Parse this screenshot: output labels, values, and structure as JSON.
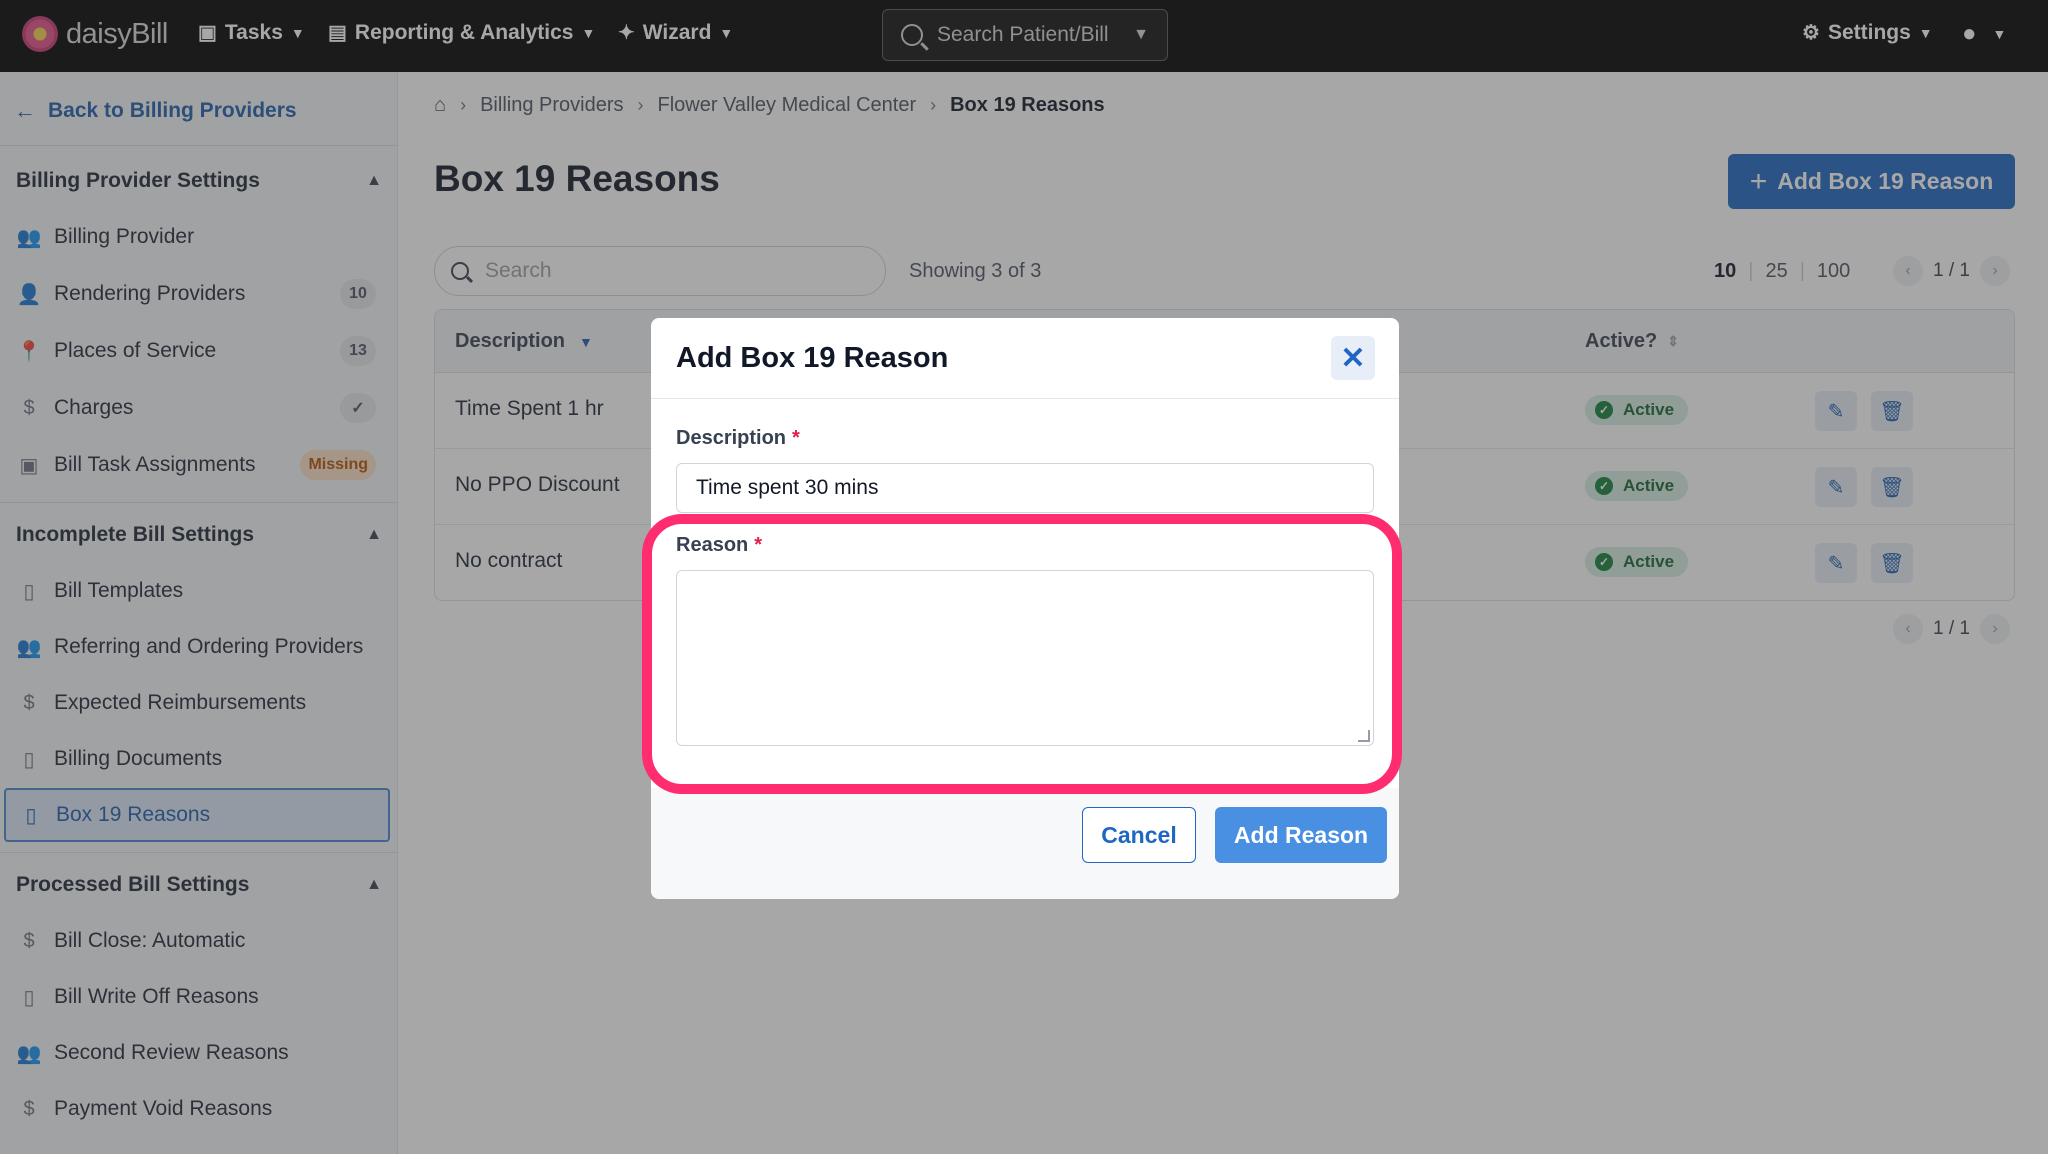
{
  "topnav": {
    "brand": "daisyBill",
    "tasks": "Tasks",
    "reporting": "Reporting & Analytics",
    "wizard": "Wizard",
    "search_placeholder": "Search Patient/Bill",
    "settings": "Settings"
  },
  "sidebar": {
    "back": "Back to Billing Providers",
    "sections": {
      "billing_provider_settings": "Billing Provider Settings",
      "incomplete_bill_settings": "Incomplete Bill Settings",
      "processed_bill_settings": "Processed Bill Settings"
    },
    "items": [
      {
        "label": "Billing Provider"
      },
      {
        "label": "Rendering Providers",
        "badge": "10"
      },
      {
        "label": "Places of Service",
        "badge": "13"
      },
      {
        "label": "Charges",
        "badge": "✓"
      },
      {
        "label": "Bill Task Assignments",
        "badge": "Missing"
      },
      {
        "label": "Bill Templates"
      },
      {
        "label": "Referring and Ordering Providers"
      },
      {
        "label": "Expected Reimbursements"
      },
      {
        "label": "Billing Documents"
      },
      {
        "label": "Box 19 Reasons"
      },
      {
        "label": "Bill Close: Automatic"
      },
      {
        "label": "Bill Write Off Reasons"
      },
      {
        "label": "Second Review Reasons"
      },
      {
        "label": "Payment Void Reasons"
      }
    ]
  },
  "breadcrumb": [
    "Billing Providers",
    "Flower Valley Medical Center",
    "Box 19 Reasons"
  ],
  "page": {
    "title": "Box 19 Reasons",
    "add_button": "Add Box 19 Reason",
    "search_placeholder": "Search",
    "showing": "Showing 3 of 3",
    "page_sizes": [
      "10",
      "25",
      "100"
    ],
    "page_indicator": "1 / 1"
  },
  "table": {
    "headers": {
      "description": "Description",
      "active": "Active?"
    },
    "rows": [
      {
        "description": "Time Spent 1 hr",
        "status": "Active"
      },
      {
        "description": "No PPO Discount",
        "status": "Active"
      },
      {
        "description": "No contract",
        "status": "Active"
      }
    ]
  },
  "modal": {
    "title": "Add Box 19 Reason",
    "description_label": "Description",
    "description_value": "Time spent 30 mins",
    "reason_label": "Reason",
    "required_mark": "*",
    "cancel": "Cancel",
    "submit": "Add Reason"
  },
  "colors": {
    "accent": "#1f67c2",
    "highlight": "#ff2d6f",
    "active_badge": "#d7efe2"
  }
}
